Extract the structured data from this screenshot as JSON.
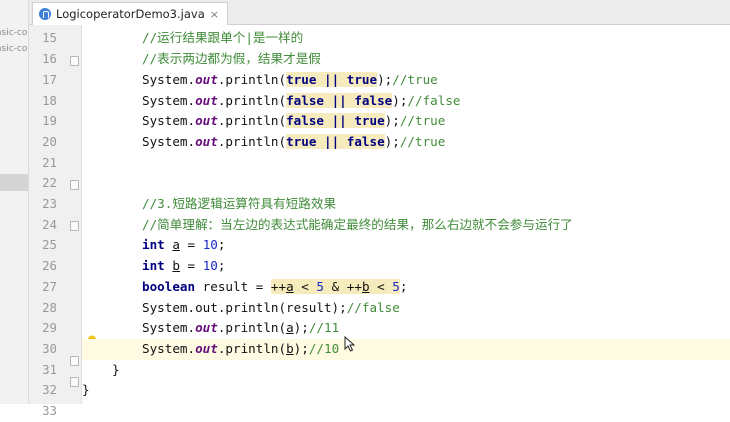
{
  "project_panel": {
    "items": [
      "asic-co",
      "asic-co"
    ]
  },
  "tab": {
    "filename": "LogicoperatorDemo3.java",
    "close": "×"
  },
  "icons": {
    "tab": "java-class-icon",
    "bulb": "lightbulb-icon",
    "cursor": "mouse-cursor-icon"
  },
  "colors": {
    "comment": "#418c3a",
    "keyword": "#000080",
    "number": "#1a28c8",
    "field": "#660e7a",
    "highlight": "#f6ebbc"
  },
  "line_numbers": [
    "15",
    "16",
    "17",
    "18",
    "19",
    "20",
    "21",
    "22",
    "23",
    "24",
    "25",
    "26",
    "27",
    "28",
    "29",
    "30",
    "31",
    "32",
    "33"
  ],
  "code": {
    "l15": "//运行结果跟单个|是一样的",
    "l16": "//表示两边都为假，结果才是假",
    "l17": {
      "pre": "System.",
      "field": "out",
      "mid": ".println(",
      "arg": "true || true",
      "post": ");",
      "comment": "//true"
    },
    "l18": {
      "pre": "System.",
      "field": "out",
      "mid": ".println(",
      "arg": "false || false",
      "post": ");",
      "comment": "//false"
    },
    "l19": {
      "pre": "System.",
      "field": "out",
      "mid": ".println(",
      "arg": "false || true",
      "post": ");",
      "comment": "//true"
    },
    "l20": {
      "pre": "System.",
      "field": "out",
      "mid": ".println(",
      "arg": "true || false",
      "post": ");",
      "comment": "//true"
    },
    "l23": "//3.短路逻辑运算符具有短路效果",
    "l24": "//简单理解：当左边的表达式能确定最终的结果，那么右边就不会参与运行了",
    "l25": {
      "kw": "int",
      "sp": " ",
      "var": "a",
      "eq": " = ",
      "num": "10",
      "end": ";"
    },
    "l26": {
      "kw": "int",
      "sp": " ",
      "var": "b",
      "eq": " = ",
      "num": "10",
      "end": ";"
    },
    "l27": {
      "kw": "boolean",
      "mid": " result = ",
      "expr1": "++",
      "v1": "a",
      "expr2": " < ",
      "n1": "5",
      "expr3": " & ++",
      "v2": "b",
      "expr4": " < ",
      "n2": "5",
      "end": ";"
    },
    "l28": {
      "text": "System.out.println(result);",
      "comment": "//false"
    },
    "l29": {
      "pre": "System.",
      "field": "out",
      "mid": ".println(",
      "var": "a",
      "post": ");",
      "comment": "//11"
    },
    "l30": {
      "pre": "System.",
      "field": "out",
      "mid": ".println(",
      "var": "b",
      "post": ");",
      "comment": "//10"
    },
    "l31": "}",
    "l32": "}"
  }
}
